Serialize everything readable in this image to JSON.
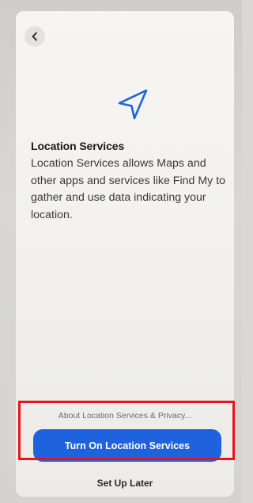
{
  "screen": {
    "back_icon": "chevron-left-icon",
    "hero_icon": "location-arrow-icon",
    "title": "Location Services",
    "description": "Location Services allows Maps and other apps and services like Find My to gather and use data indicating your location.",
    "privacy_link": "About Location Services & Privacy...",
    "primary_button_label": "Turn On Location Services",
    "secondary_button_label": "Set Up Later"
  },
  "colors": {
    "accent": "#1f62de",
    "highlight": "#e8141d"
  }
}
